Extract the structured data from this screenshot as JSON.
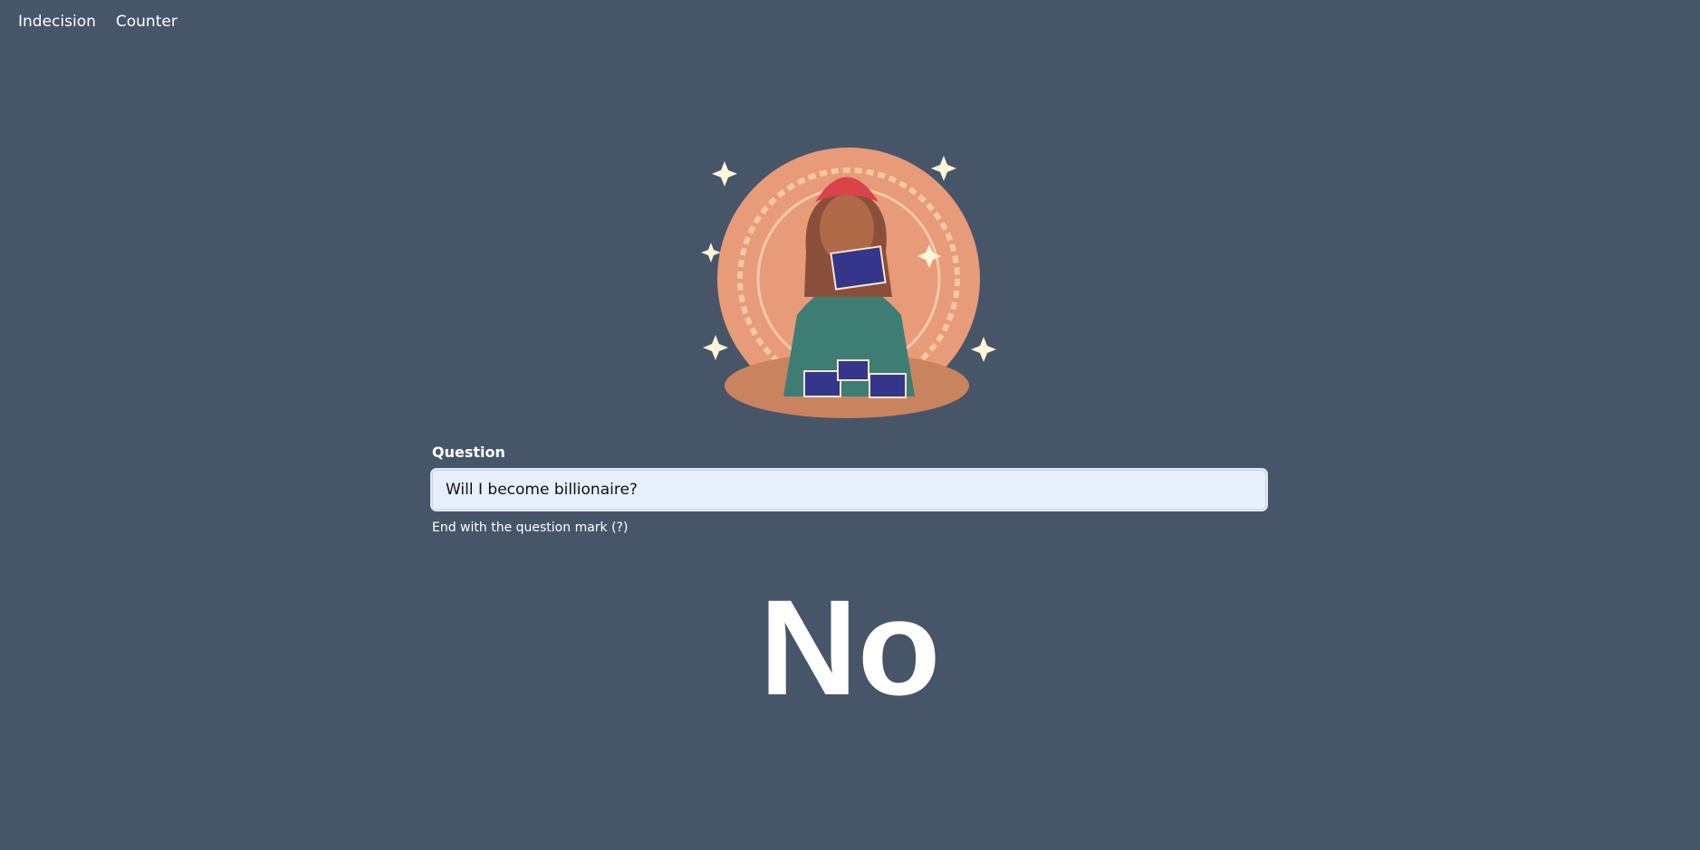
{
  "nav": {
    "items": [
      {
        "label": "Indecision"
      },
      {
        "label": "Counter"
      }
    ]
  },
  "hero": {
    "image": "fortune-teller-illustration"
  },
  "form": {
    "label": "Question",
    "value": "Will I become billionaire?",
    "help": "End with the question mark (?)"
  },
  "answer": "No",
  "colors": {
    "background": "#475569",
    "input_bg": "#e8f0fe"
  }
}
